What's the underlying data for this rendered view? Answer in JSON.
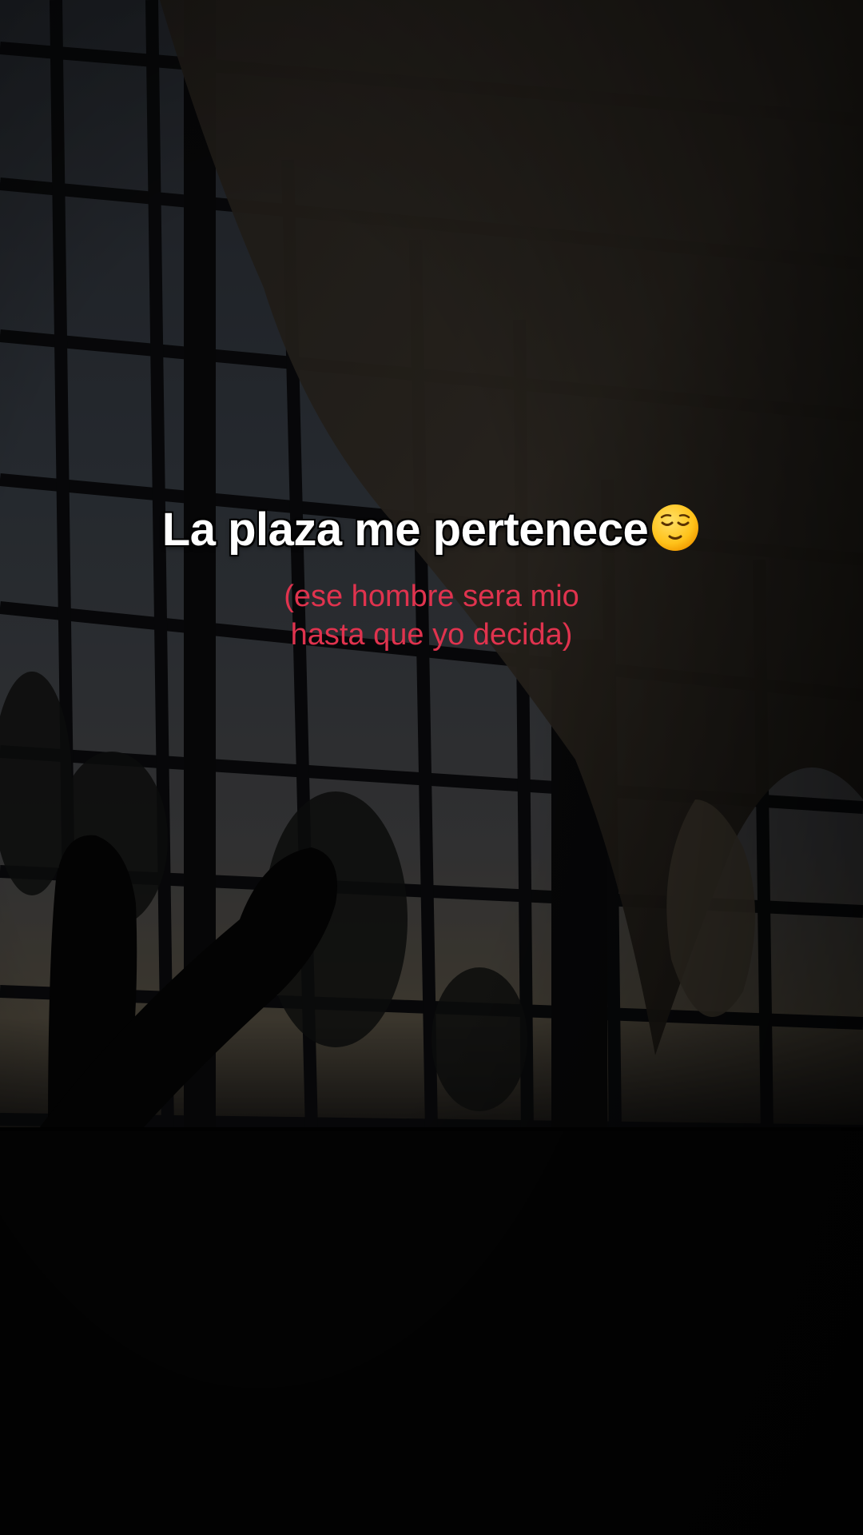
{
  "caption": {
    "main": "La plaza me pertenece",
    "emoji": "relieved-face-emoji",
    "sub_line1": "(ese hombre sera mio",
    "sub_line2": "hasta que yo decida)"
  },
  "colors": {
    "main_text": "#ffffff",
    "sub_text": "#e0334e",
    "background": "#030303"
  }
}
